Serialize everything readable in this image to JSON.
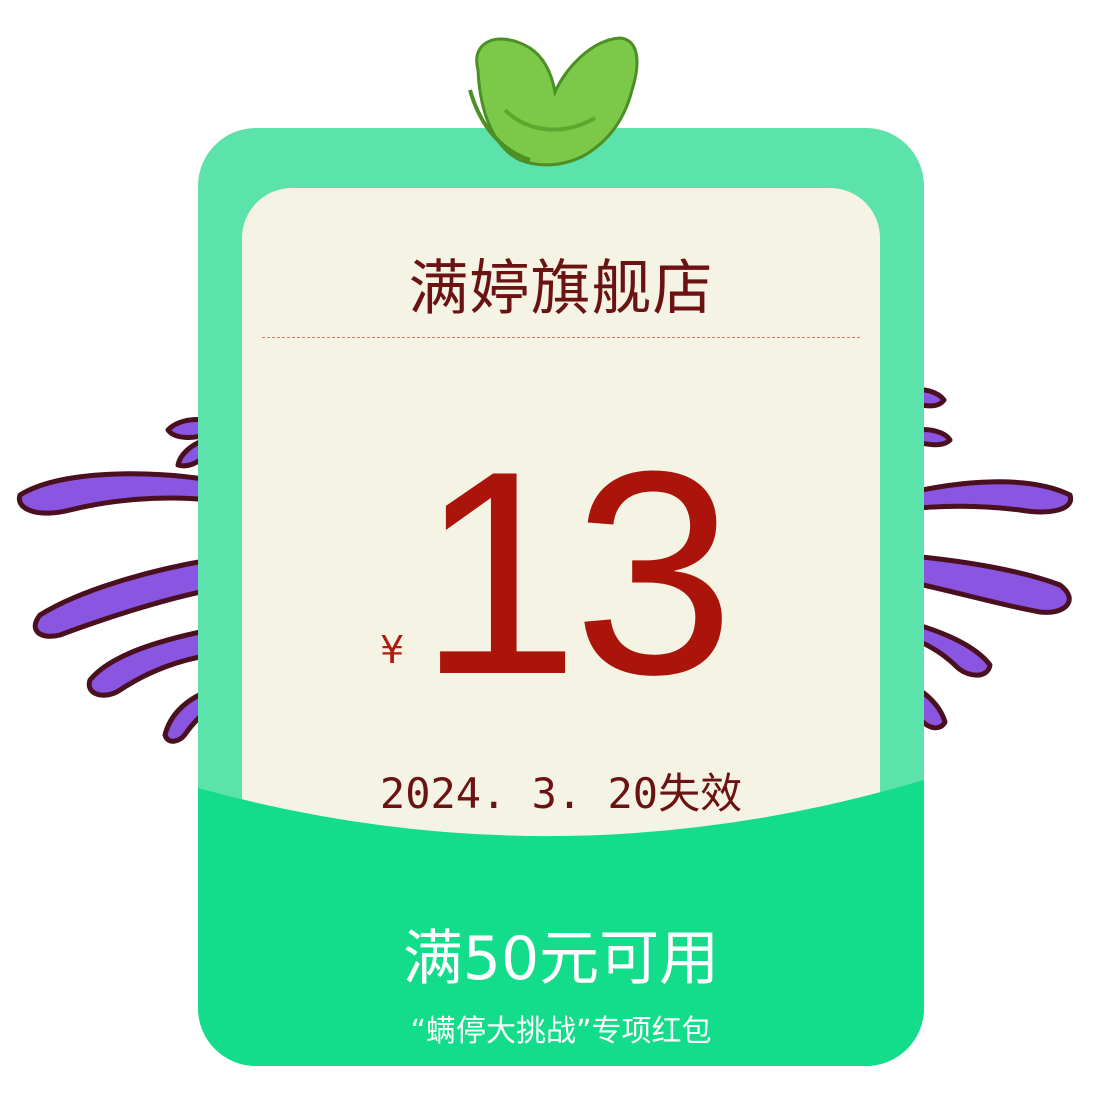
{
  "coupon": {
    "shop_name": "满婷旗舰店",
    "currency_symbol": "¥",
    "amount": "13",
    "expiry": "2024. 3. 20失效",
    "threshold": "满50元可用",
    "subtitle": "“螨停大挑战”专项红包"
  },
  "colors": {
    "card_green": "#5ce2ab",
    "bottom_green": "#13dc8a",
    "inner_cream": "#f5f3e4",
    "text_dark_red": "#6b1212",
    "amount_red": "#ab140b",
    "splash_purple": "#8a55e0",
    "leaf_green": "#7cc94a"
  },
  "icons": [
    "leaf-icon",
    "purple-splash-left",
    "purple-splash-right"
  ]
}
